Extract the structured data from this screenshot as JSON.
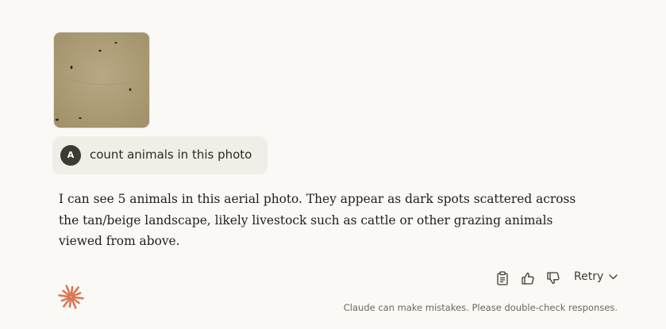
{
  "attachment": {
    "image_kind": "aerial-photo-thumbnail",
    "colors": {
      "ground": "#b8a882",
      "spots": "#2a2418"
    }
  },
  "user_message": {
    "avatar_initial": "A",
    "text": "count animals in this photo"
  },
  "assistant_message": {
    "text": "I can see 5 animals in this aerial photo. They appear as dark spots scattered across the tan/beige landscape, likely livestock such as cattle or other grazing animals viewed from above."
  },
  "actions": {
    "copy_icon": "clipboard-icon",
    "thumbs_up_icon": "thumbs-up-icon",
    "thumbs_down_icon": "thumbs-down-icon",
    "retry_label": "Retry"
  },
  "footer": {
    "logo_icon": "claude-spark-icon",
    "disclaimer": "Claude can make mistakes. Please double-check responses."
  },
  "colors": {
    "background": "#faf9f5",
    "bubble": "#f0eee6",
    "avatar": "#3d3a33",
    "accent_logo": "#d97757"
  }
}
